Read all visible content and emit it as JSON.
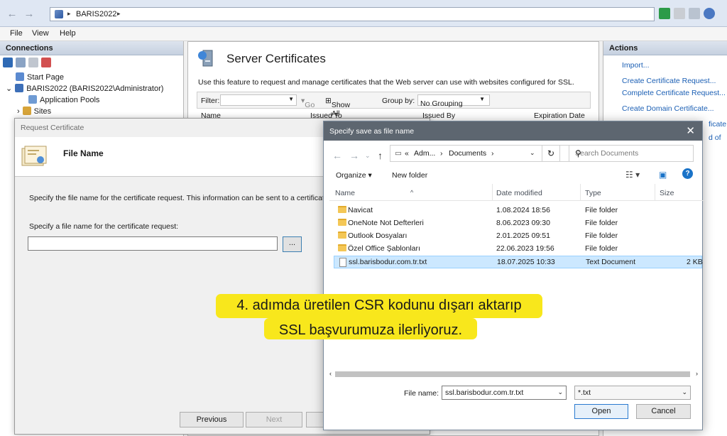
{
  "nav": {
    "back": "←",
    "forward": "→",
    "crumb": "BARIS2022",
    "sep": "▸"
  },
  "menu": {
    "file": "File",
    "view": "View",
    "help": "Help"
  },
  "connections": {
    "title": "Connections",
    "tree": [
      "Start Page",
      "BARIS2022 (BARIS2022\\Administrator)",
      "Application Pools",
      "Sites"
    ]
  },
  "center": {
    "title": "Server Certificates",
    "description": "Use this feature to request and manage certificates that the Web server can use with websites configured for SSL.",
    "filter_label": "Filter:",
    "go": "Go",
    "show_all": "Show All",
    "group_by": "Group by:",
    "group_value": "No Grouping",
    "columns": [
      "Name",
      "Issued To",
      "Issued By",
      "Expiration Date"
    ]
  },
  "actions": {
    "title": "Actions",
    "items": [
      "Import...",
      "Create Certificate Request...",
      "Complete Certificate Request...",
      "Create Domain Certificate...",
      "ficate...",
      "d of"
    ]
  },
  "wizard": {
    "title": "Request Certificate",
    "heading": "File Name",
    "description": "Specify the file name for the certificate request. This information can be sent to a certificati signing.",
    "label": "Specify a file name for the certificate request:",
    "input_value": "",
    "browse": "...",
    "previous": "Previous",
    "next": "Next"
  },
  "save_dialog": {
    "title": "Specify save as file name",
    "close": "✕",
    "path_prefix": "«",
    "path_adm": "Adm...",
    "path_sep": "›",
    "path_docs": "Documents",
    "search_placeholder": "Search Documents",
    "organize": "Organize ▾",
    "new_folder": "New folder",
    "columns": {
      "name": "Name",
      "date": "Date modified",
      "type": "Type",
      "size": "Size"
    },
    "files": [
      {
        "name": "Navicat",
        "date": "1.08.2024 18:56",
        "type": "File folder",
        "size": "",
        "kind": "folder"
      },
      {
        "name": "OneNote Not Defterleri",
        "date": "8.06.2023 09:30",
        "type": "File folder",
        "size": "",
        "kind": "folder"
      },
      {
        "name": "Outlook Dosyaları",
        "date": "2.01.2025 09:51",
        "type": "File folder",
        "size": "",
        "kind": "folder"
      },
      {
        "name": "Özel Office Şablonları",
        "date": "22.06.2023 19:56",
        "type": "File folder",
        "size": "",
        "kind": "folder"
      },
      {
        "name": "ssl.barisbodur.com.tr.txt",
        "date": "18.07.2025 10:33",
        "type": "Text Document",
        "size": "2 KB",
        "kind": "txt"
      }
    ],
    "filename_label": "File name:",
    "filename_value": "ssl.barisbodur.com.tr.txt",
    "filetype": "*.txt",
    "open": "Open",
    "cancel": "Cancel"
  },
  "caption": {
    "line1": "4. adımda üretilen CSR kodunu dışarı aktarıp",
    "line2": "SSL başvurumuza ilerliyoruz."
  },
  "colors": {
    "accent": "#1a73c8",
    "caption_bg": "#f8e71c",
    "link": "#1b5fb4"
  }
}
